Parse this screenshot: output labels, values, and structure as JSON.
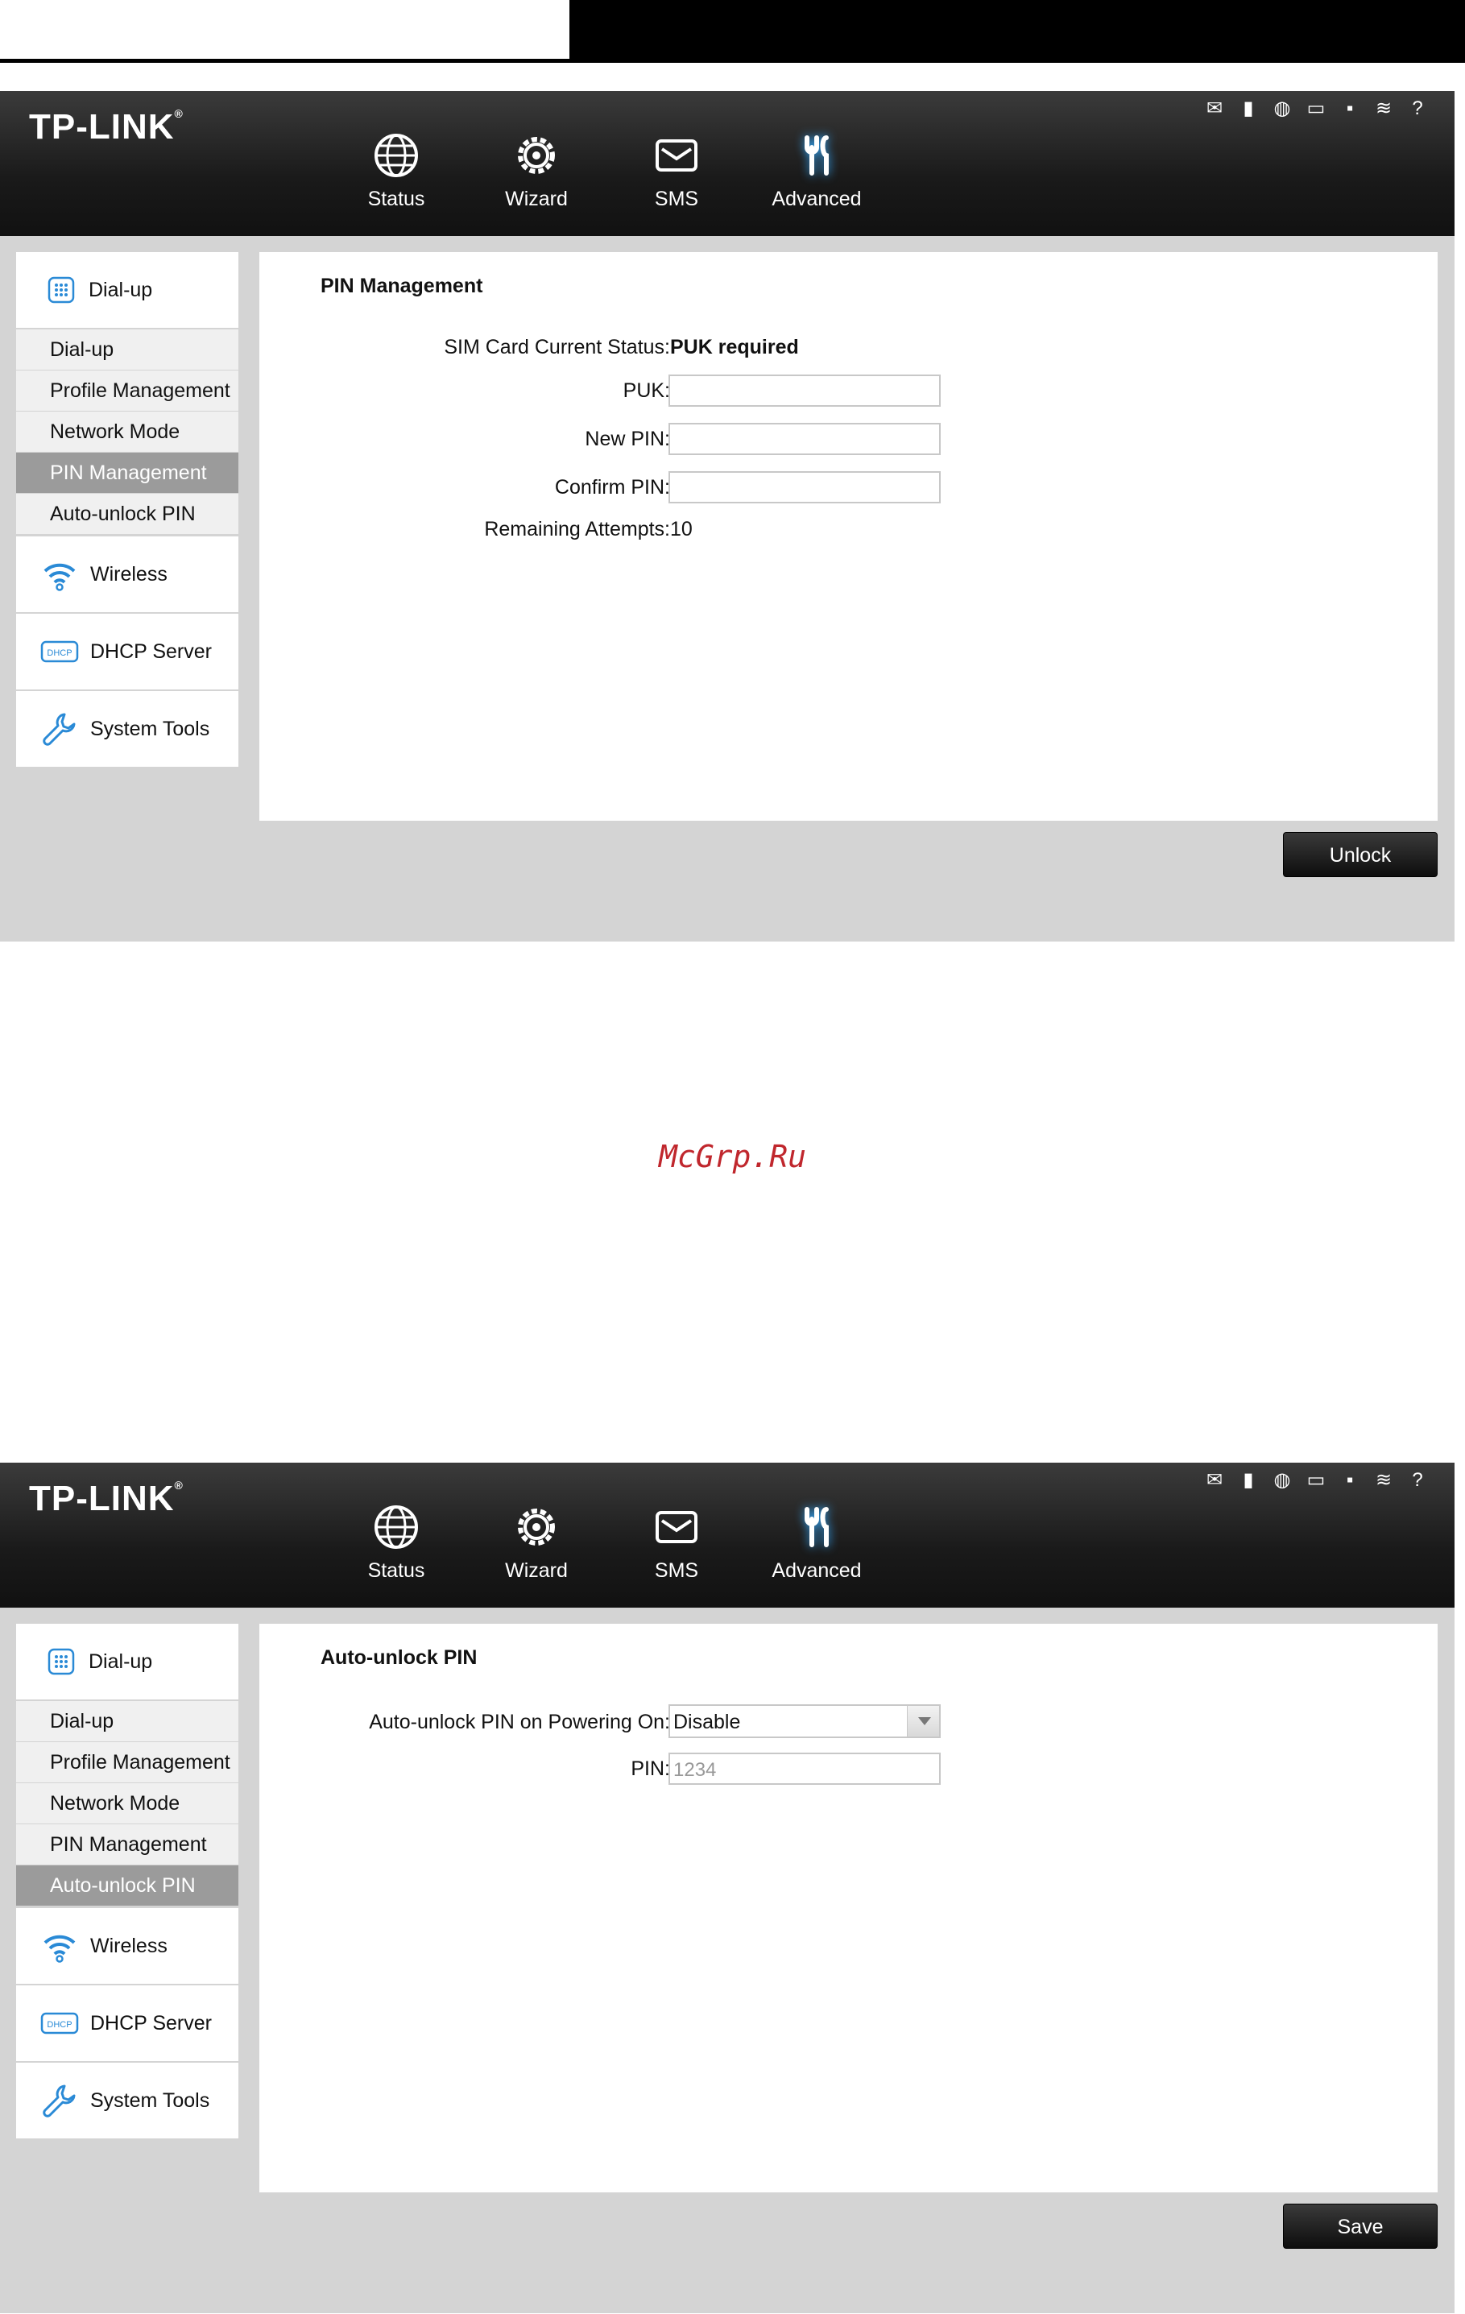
{
  "brand": {
    "logo_text": "TP-LINK",
    "logo_mark": "®"
  },
  "nav": [
    {
      "label": "Status",
      "icon": "globe-icon"
    },
    {
      "label": "Wizard",
      "icon": "gear-icon"
    },
    {
      "label": "SMS",
      "icon": "envelope-icon"
    },
    {
      "label": "Advanced",
      "icon": "tools-icon",
      "active": true
    }
  ],
  "status_icons": [
    "message-icon",
    "signal-icon",
    "internet-icon",
    "battery-icon",
    "sd-card-icon",
    "wifi-icon",
    "help-icon"
  ],
  "sidebar": {
    "dialup_head": "Dial-up",
    "items": [
      "Dial-up",
      "Profile Management",
      "Network Mode",
      "PIN Management",
      "Auto-unlock PIN"
    ],
    "wireless": "Wireless",
    "dhcp": "DHCP Server",
    "dhcp_badge": "DHCP",
    "system_tools": "System Tools"
  },
  "screen1": {
    "title": "PIN Management",
    "sim_status_label": "SIM Card Current Status:",
    "sim_status_value": "PUK required",
    "puk_label": "PUK:",
    "new_pin_label": "New PIN:",
    "confirm_pin_label": "Confirm PIN:",
    "remaining_label": "Remaining Attempts:",
    "remaining_value": "10",
    "button": "Unlock"
  },
  "watermark": "McGrp.Ru",
  "screen2": {
    "title": "Auto-unlock PIN",
    "auto_label": "Auto-unlock PIN on Powering On:",
    "auto_value": "Disable",
    "pin_label": "PIN:",
    "pin_placeholder": "1234",
    "button": "Save"
  },
  "colors": {
    "topbar": "#1a1a1a",
    "active_side": "#9b9b9b",
    "icon_blue": "#2a8ad6",
    "watermark": "#c0272d"
  }
}
